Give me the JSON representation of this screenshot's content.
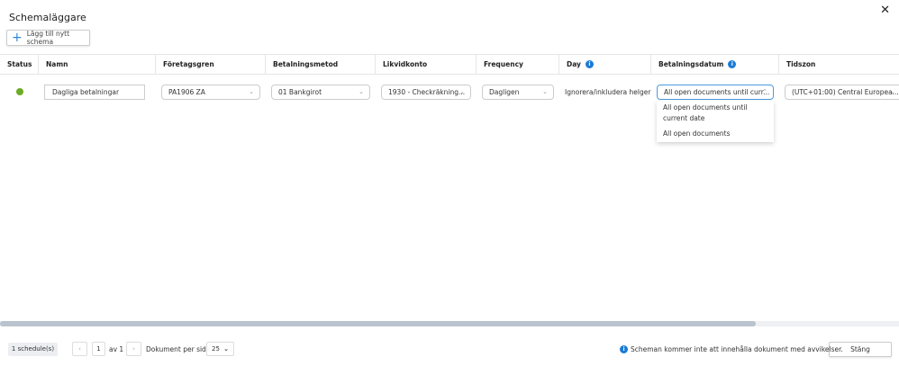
{
  "title": "Schemaläggare",
  "add_button": "Lägg till nytt schema",
  "columns": [
    "Status",
    "Namn",
    "Företagsgren",
    "Betalningsmetod",
    "Likvidkonto",
    "Frequency",
    "Day",
    "Betalningsdatum",
    "Tidszon"
  ],
  "row": {
    "status_color": "#6aac24",
    "name": "Dagliga betalningar",
    "branch": "PA1906 ZA",
    "method": "01 Bankgirot",
    "account": "1930 - Checkräkning...",
    "frequency": "Dagligen",
    "day": "Ignorera/inkludera helger",
    "payment_date": "All open documents until curr...",
    "timezone": "(UTC+01:00) Central Europea..."
  },
  "dropdown_options": [
    "All open documents until current date",
    "All open documents"
  ],
  "footer": {
    "count": "1 schedule(s)",
    "page": "1",
    "of": "av 1",
    "per_page_label": "Dokument per sida",
    "per_page": "25",
    "notice": "Scheman kommer inte att innehålla dokument med avvikelser.",
    "close": "Stäng"
  },
  "accent": "#1b7bd6"
}
